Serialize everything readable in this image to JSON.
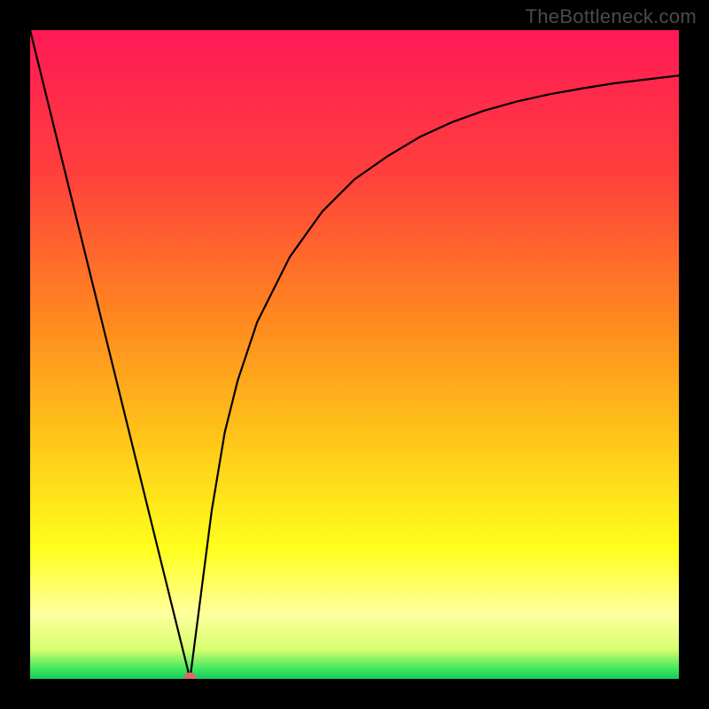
{
  "watermark": "TheBottleneck.com",
  "chart_data": {
    "type": "line",
    "x": [
      0.0,
      0.05,
      0.1,
      0.15,
      0.2,
      0.2465,
      0.28,
      0.3,
      0.32,
      0.35,
      0.4,
      0.45,
      0.5,
      0.55,
      0.6,
      0.65,
      0.7,
      0.75,
      0.8,
      0.85,
      0.9,
      0.95,
      1.0
    ],
    "values": [
      1.0,
      0.797,
      0.594,
      0.391,
      0.188,
      0.0,
      0.26,
      0.38,
      0.46,
      0.55,
      0.65,
      0.72,
      0.77,
      0.805,
      0.835,
      0.858,
      0.876,
      0.89,
      0.901,
      0.91,
      0.918,
      0.924,
      0.93
    ],
    "xlim": [
      0,
      1
    ],
    "ylim": [
      0,
      1
    ],
    "xlabel": "",
    "ylabel": "",
    "title": "",
    "marker": {
      "x": 0.2465,
      "y": 0.003
    },
    "background_gradient_stops": [
      {
        "pos": 0.0,
        "color": "#ff1a57"
      },
      {
        "pos": 0.22,
        "color": "#ff3f3c"
      },
      {
        "pos": 0.45,
        "color": "#ff8a1f"
      },
      {
        "pos": 0.62,
        "color": "#ffc21a"
      },
      {
        "pos": 0.8,
        "color": "#ffff1c"
      },
      {
        "pos": 0.9,
        "color": "#ffff9e"
      },
      {
        "pos": 0.955,
        "color": "#d6ff6e"
      },
      {
        "pos": 0.985,
        "color": "#3ee65e"
      },
      {
        "pos": 1.0,
        "color": "#18c95c"
      }
    ]
  }
}
